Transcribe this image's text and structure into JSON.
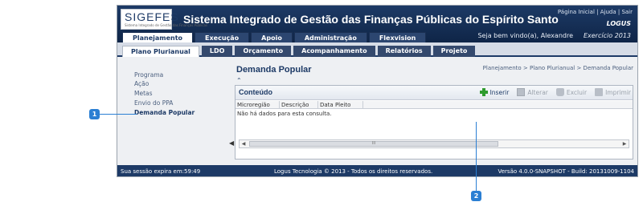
{
  "header": {
    "logo": "SIGEFES",
    "logo_sub": "Sistema Integrado de Gestão das Finanças Públicas",
    "title": "Sistema Integrado de Gestão das Finanças Públicas do Espírito Santo",
    "links": [
      "Página Inicial",
      "Ajuda",
      "Sair"
    ],
    "brand": "LOGUS",
    "welcome": "Seja bem vindo(a), Alexandre",
    "exercicio": "Exercício 2013"
  },
  "main_tabs": [
    "Planejamento",
    "Execução",
    "Apoio",
    "Administração",
    "Flexvision"
  ],
  "sub_tabs": [
    "Plano Plurianual",
    "LDO",
    "Orçamento",
    "Acompanhamento",
    "Relatórios",
    "Projeto"
  ],
  "sidebar": {
    "items": [
      "Programa",
      "Ação",
      "Metas",
      "Envio do PPA",
      "Demanda Popular"
    ]
  },
  "content": {
    "title": "Demanda Popular",
    "breadcrumb": "Planejamento > Plano Plurianual > Demanda Popular",
    "panel_title": "Conteúdo",
    "toolbar": {
      "insert": "Inserir",
      "edit": "Alterar",
      "delete": "Excluir",
      "print": "Imprimir"
    },
    "columns": [
      "Microregião",
      "Descrição",
      "Data Pleito"
    ],
    "empty_message": "Não há dados para esta consulta."
  },
  "footer": {
    "session": "Sua sessão expira em:59:49",
    "copyright": "Logus Tecnologia © 2013 - Todos os direitos reservados.",
    "version": "Versão 4.0.0-SNAPSHOT - Build: 20131009-1104"
  },
  "markers": [
    "1",
    "2"
  ],
  "colors": {
    "primary": "#1d3a66",
    "marker": "#2b7fd3",
    "insert": "#2e9b2e"
  }
}
